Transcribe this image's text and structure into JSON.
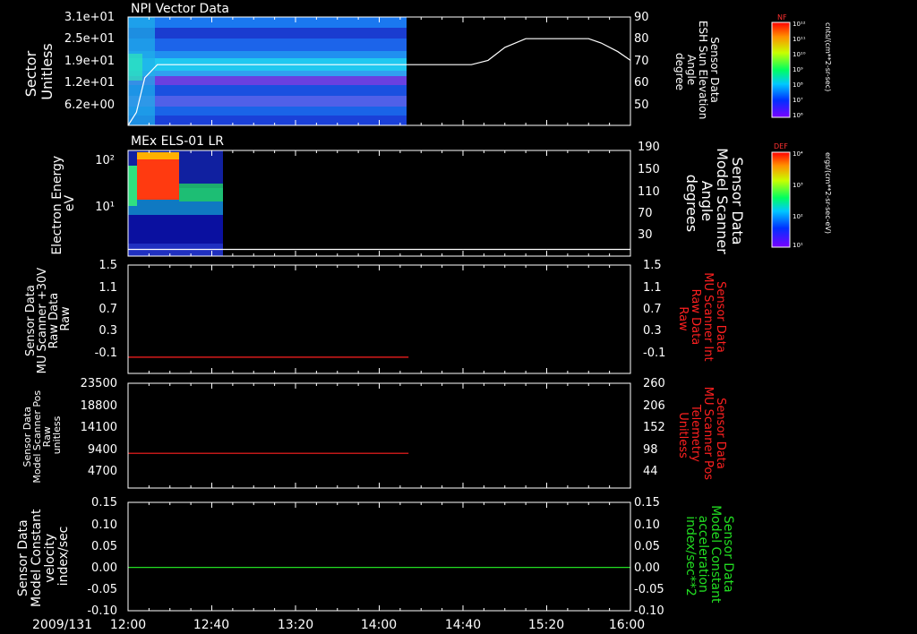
{
  "colors": {
    "background": "#000000",
    "axis": "#ffffff",
    "red_trace": "#ff2020",
    "green_trace": "#22dd22",
    "white_trace": "#ffffff"
  },
  "time_axis": {
    "date_label": "2009/131",
    "ticks": [
      "12:00",
      "12:40",
      "13:20",
      "14:00",
      "14:40",
      "15:20",
      "16:00"
    ]
  },
  "colorbars": [
    {
      "title": "NF",
      "units": "cnts/(cm**2-sr-sec)",
      "ticks": [
        "10¹²",
        "10¹¹",
        "10¹⁰",
        "10⁹",
        "10⁸",
        "10⁷",
        "10⁶"
      ]
    },
    {
      "title": "DEF",
      "units": "ergs/(cm**2-sr-sec-eV)",
      "ticks": [
        "10⁴",
        "10³",
        "10²",
        "10¹"
      ]
    }
  ],
  "chart_data": [
    {
      "type": "heatmap",
      "title": "NPI Vector Data",
      "ylabel_lines": [
        "Sector",
        "Unitless"
      ],
      "y_ticks": [
        "3.1e+01",
        "2.5e+01",
        "1.9e+01",
        "1.2e+01",
        "6.2e+00"
      ],
      "x_range": [
        "12:00",
        "14:12"
      ],
      "overlay": {
        "type": "line",
        "ylabel_lines": [
          "Sensor Data",
          "ESH Sun Elevation",
          "Angle",
          "degree"
        ],
        "y_ticks": [
          "90",
          "80",
          "70",
          "60",
          "50"
        ],
        "ylim": [
          40,
          90
        ],
        "x_minutes": [
          0,
          4,
          8,
          14,
          30,
          60,
          90,
          120,
          150,
          158,
          164,
          172,
          180,
          190,
          200,
          210,
          220,
          226,
          234,
          240
        ],
        "y": [
          40,
          46,
          62,
          68,
          68,
          68,
          68,
          68,
          68,
          68,
          68,
          70,
          76,
          80,
          80,
          80,
          80,
          78,
          74,
          70
        ]
      }
    },
    {
      "type": "heatmap",
      "title": "MEx ELS-01 LR",
      "ylabel_lines": [
        "Electron Energy",
        "eV"
      ],
      "y_ticks": [
        "10²",
        "10¹"
      ],
      "x_range": [
        "12:00",
        "12:18"
      ],
      "overlay": {
        "type": "line",
        "ylabel_lines": [
          "Sensor Data",
          "Model Scanner",
          "Angle",
          "degrees"
        ],
        "y_ticks": [
          "190",
          "150",
          "110",
          "70",
          "30"
        ],
        "ylim": [
          0,
          190
        ],
        "x_minutes": [
          0,
          240
        ],
        "y": [
          12,
          12
        ]
      }
    },
    {
      "type": "line",
      "ylabel_lines": [
        "Sensor Data",
        "MU Scanner +30V",
        "Raw Data",
        "Raw"
      ],
      "y_ticks": [
        "1.5",
        "1.1",
        "0.7",
        "0.3",
        "-0.1"
      ],
      "ylim": [
        -0.3,
        1.5
      ],
      "right_ylabel_lines": [
        "Sensor Data",
        "MU Scanner Int",
        "Raw Data",
        "Raw"
      ],
      "right_y_ticks": [
        "1.5",
        "1.1",
        "0.7",
        "0.3",
        "-0.1"
      ],
      "series": [
        {
          "color": "red",
          "x_minutes": [
            0,
            134
          ],
          "y": [
            -0.03,
            -0.03
          ]
        }
      ]
    },
    {
      "type": "line",
      "ylabel_lines": [
        "Sensor Data",
        "Model Scanner Pos",
        "Raw",
        "unitless"
      ],
      "y_ticks": [
        "23500",
        "18800",
        "14100",
        "9400",
        "4700"
      ],
      "ylim": [
        0,
        23500
      ],
      "right_ylabel_lines": [
        "Sensor Data",
        "MU Scanner Pos",
        "Telemetry",
        "Unitless"
      ],
      "right_y_ticks": [
        "260",
        "206",
        "152",
        "98",
        "44"
      ],
      "series": [
        {
          "color": "red",
          "x_minutes": [
            0,
            134
          ],
          "y": [
            7800,
            7800
          ]
        }
      ]
    },
    {
      "type": "line",
      "ylabel_lines": [
        "Sensor Data",
        "Model Constant",
        "velocity",
        "index/sec"
      ],
      "y_ticks": [
        "0.15",
        "0.10",
        "0.05",
        "0.00",
        "-0.05",
        "-0.10"
      ],
      "ylim": [
        -0.1,
        0.15
      ],
      "right_ylabel_lines": [
        "Sensor Data",
        "Model Constant",
        "acceleration",
        "index/sec**2"
      ],
      "right_y_ticks": [
        "0.15",
        "0.10",
        "0.05",
        "0.00",
        "-0.05",
        "-0.10"
      ],
      "series": [
        {
          "color": "green",
          "x_minutes": [
            0,
            240
          ],
          "y": [
            0.0,
            0.0
          ]
        }
      ]
    }
  ]
}
